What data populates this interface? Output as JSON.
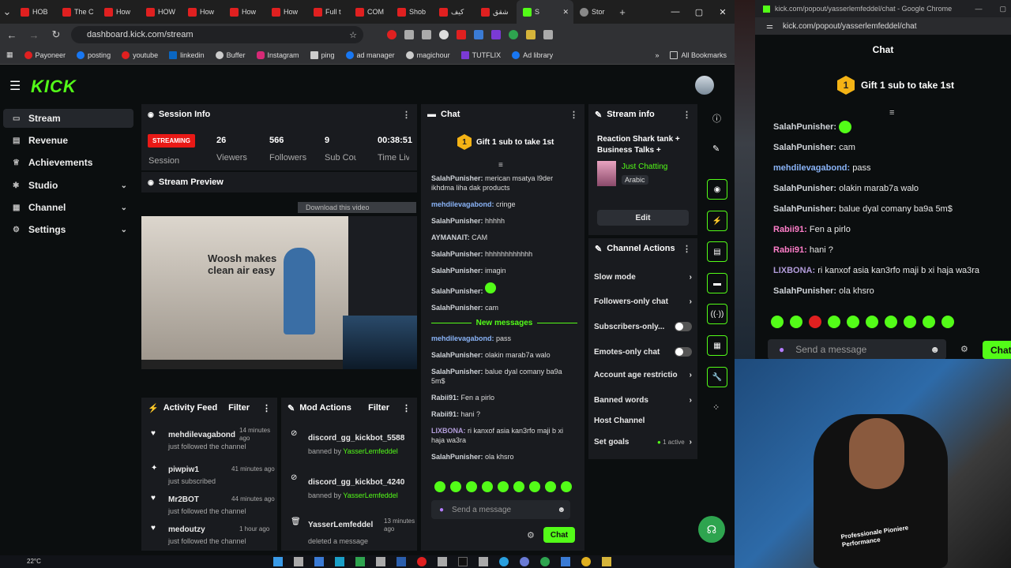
{
  "tabs": [
    {
      "label": "HOB"
    },
    {
      "label": "The C"
    },
    {
      "label": "How"
    },
    {
      "label": "HOW"
    },
    {
      "label": "How"
    },
    {
      "label": "How"
    },
    {
      "label": "How"
    },
    {
      "label": "Full t"
    },
    {
      "label": "COM"
    },
    {
      "label": "Shob"
    },
    {
      "label": "كيف"
    },
    {
      "label": "شقق"
    },
    {
      "label": "S"
    },
    {
      "label": "Stor"
    }
  ],
  "address": {
    "url": "dashboard.kick.com/stream"
  },
  "bookmarks": [
    "Payoneer",
    "posting",
    "youtube",
    "linkedin",
    "Buffer",
    "Instagram",
    "ping",
    "ad manager",
    "magichour",
    "TUTFLIX",
    "Ad library"
  ],
  "bookmarks_all": "All Bookmarks",
  "logo": "KICK",
  "sidebar": {
    "items": [
      {
        "label": "Stream"
      },
      {
        "label": "Revenue"
      },
      {
        "label": "Achievements"
      },
      {
        "label": "Studio"
      },
      {
        "label": "Channel"
      },
      {
        "label": "Settings"
      }
    ]
  },
  "session": {
    "title": "Session Info",
    "status": "STREAMING",
    "session_label": "Session",
    "viewers": "26",
    "viewers_label": "Viewers",
    "followers": "566",
    "followers_label": "Followers",
    "subs": "9",
    "subs_label": "Sub Counts",
    "time": "00:38:51",
    "time_label": "Time Live"
  },
  "preview": {
    "title": "Stream Preview",
    "download": "Download this video",
    "video_text": "Woosh makes clean air easy"
  },
  "chat": {
    "title": "Chat",
    "gift": "Gift 1 sub to take 1st",
    "gift_rank": "1",
    "messages": [
      {
        "user": "SalahPunisher:",
        "text": " merican msatya l9der ikhdma liha dak products"
      },
      {
        "user": "mehdilevagabond:",
        "text": " cringe"
      },
      {
        "user": "SalahPunisher:",
        "text": " hhhhh"
      },
      {
        "user": "AYMANAIT:",
        "text": " CAM"
      },
      {
        "user": "SalahPunisher:",
        "text": " hhhhhhhhhhhh"
      },
      {
        "user": "SalahPunisher:",
        "text": " imagin"
      },
      {
        "user": "SalahPunisher:",
        "text": ""
      },
      {
        "user": "SalahPunisher:",
        "text": " cam"
      }
    ],
    "new_messages": "New messages",
    "messages2": [
      {
        "user": "mehdilevagabond:",
        "text": " pass"
      },
      {
        "user": "SalahPunisher:",
        "text": " olakin marab7a walo"
      },
      {
        "user": "SalahPunisher:",
        "text": " balue dyal comany ba9a 5m$"
      },
      {
        "user": "Rabii91:",
        "text": " Fen a pirlo"
      },
      {
        "user": "Rabii91:",
        "text": " hani ?"
      },
      {
        "user": "LIXBONA:",
        "text": " ri kanxof asia kan3rfo maji b xi haja wa3ra"
      },
      {
        "user": "SalahPunisher:",
        "text": " ola khsro"
      }
    ],
    "placeholder": "Send a message",
    "send": "Chat"
  },
  "stream_info": {
    "title": "Stream info",
    "stream_title": "Reaction Shark tank + Business Talks +",
    "category": "Just Chatting",
    "language": "Arabic",
    "edit": "Edit"
  },
  "channel_actions": {
    "title": "Channel Actions",
    "items": [
      {
        "label": "Slow mode"
      },
      {
        "label": "Followers-only chat"
      },
      {
        "label": "Subscribers-only..."
      },
      {
        "label": "Emotes-only chat"
      },
      {
        "label": "Account age restrictio"
      },
      {
        "label": "Banned words"
      },
      {
        "label": "Host Channel"
      },
      {
        "label": "Set goals"
      }
    ],
    "goals_badge": "1 active"
  },
  "activity": {
    "title": "Activity Feed",
    "filter": "Filter",
    "items": [
      {
        "user": "mehdilevagabond",
        "action": "just followed the channel",
        "time": "14 minutes ago"
      },
      {
        "user": "piwpiw1",
        "action": "just subscribed",
        "time": "41 minutes ago"
      },
      {
        "user": "Mr2BOT",
        "action": "just followed the channel",
        "time": "44 minutes ago"
      },
      {
        "user": "medoutzy",
        "action": "just followed the channel",
        "time": "1 hour ago"
      }
    ]
  },
  "mod": {
    "title": "Mod Actions",
    "filter": "Filter",
    "items": [
      {
        "user": "discord_gg_kickbot_5588",
        "action": "banned by",
        "by": "YasserLemfeddel",
        "time": ""
      },
      {
        "user": "discord_gg_kickbot_4240",
        "action": "banned by",
        "by": "YasserLemfeddel",
        "time": ""
      },
      {
        "user": "YasserLemfeddel",
        "action": "deleted a message",
        "by": "",
        "time": "13 minutes ago"
      }
    ]
  },
  "popout": {
    "window_title": "kick.com/popout/yasserlemfeddel/chat - Google Chrome",
    "url": "kick.com/popout/yasserlemfeddel/chat",
    "header": "Chat",
    "gift": "Gift 1 sub to take 1st",
    "gift_rank": "1",
    "messages": [
      {
        "user": "SalahPunisher:",
        "text": ""
      },
      {
        "user": "SalahPunisher:",
        "text": " cam"
      },
      {
        "user": "mehdilevagabond:",
        "text": " pass"
      },
      {
        "user": "SalahPunisher:",
        "text": " olakin marab7a walo"
      },
      {
        "user": "SalahPunisher:",
        "text": " balue dyal comany ba9a 5m$"
      },
      {
        "user": "Rabii91:",
        "text": " Fen a pirlo"
      },
      {
        "user": "Rabii91:",
        "text": " hani ?"
      },
      {
        "user": "LIXBONA:",
        "text": " ri kanxof asia kan3rfo maji b xi haja wa3ra"
      },
      {
        "user": "SalahPunisher:",
        "text": " ola khsro"
      }
    ],
    "placeholder": "Send a message",
    "send": "Chat"
  },
  "webcam": {
    "shirt_text": "Professionale Pioniere Performance"
  },
  "taskbar": {
    "weather": "22°C"
  },
  "colors": {
    "accent": "#53fc18",
    "live": "#e91916",
    "bg": "#0b0e0f",
    "panel": "#191b1f"
  }
}
